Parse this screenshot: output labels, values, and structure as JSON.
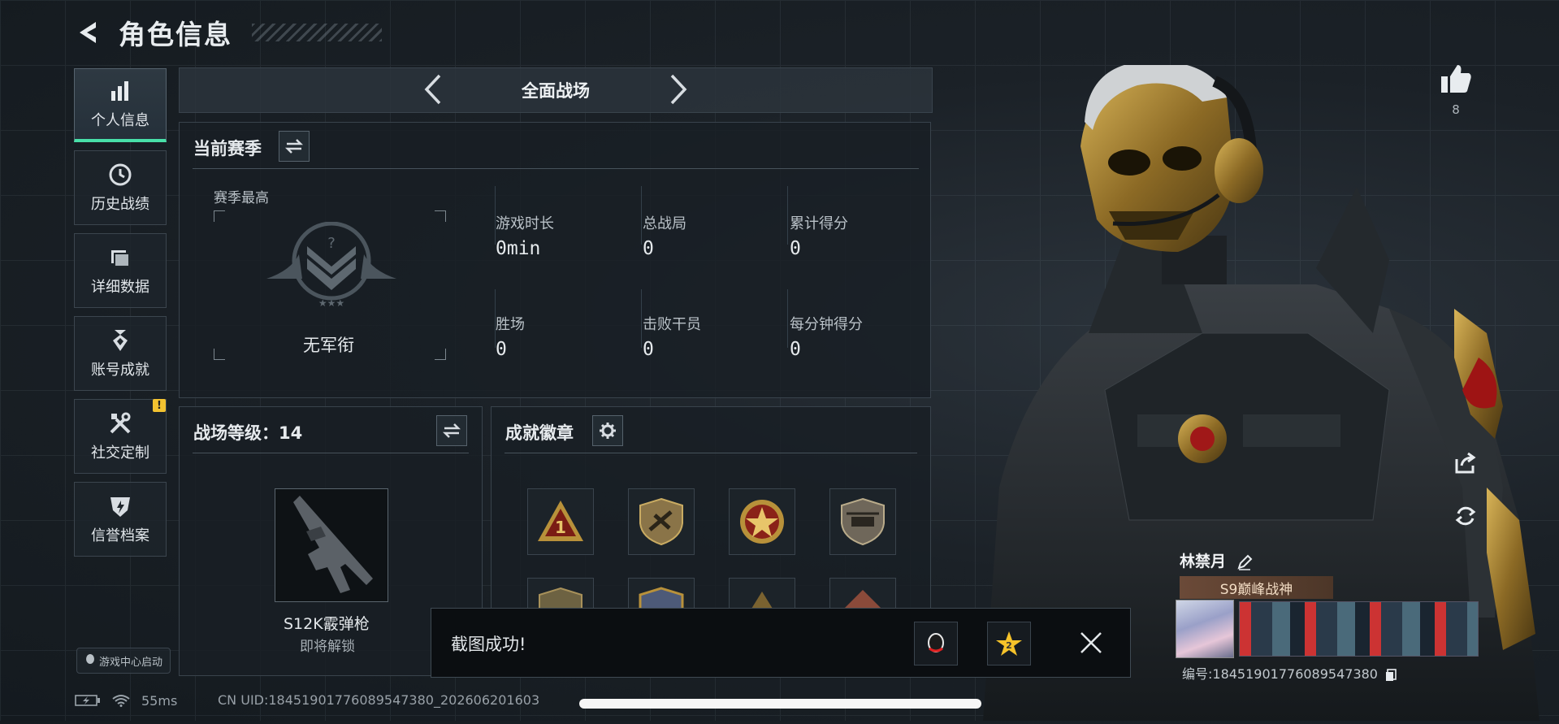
{
  "header": {
    "title": "角色信息"
  },
  "sidebar": {
    "items": [
      {
        "label": "个人信息",
        "icon": "bar-chart-icon",
        "active": true
      },
      {
        "label": "历史战绩",
        "icon": "clock-icon"
      },
      {
        "label": "详细数据",
        "icon": "folder-icon"
      },
      {
        "label": "账号成就",
        "icon": "medal-icon"
      },
      {
        "label": "社交定制",
        "icon": "tools-icon",
        "badge": "!"
      },
      {
        "label": "信誉档案",
        "icon": "shield-bolt-icon"
      }
    ],
    "game_center": "游戏中心启动"
  },
  "mode": {
    "label": "全面战场"
  },
  "season": {
    "title": "当前赛季",
    "best_label": "赛季最高",
    "rank": "无军衔",
    "stats": [
      {
        "label": "游戏时长",
        "value": "0min"
      },
      {
        "label": "总战局",
        "value": "0"
      },
      {
        "label": "累计得分",
        "value": "0"
      },
      {
        "label": "胜场",
        "value": "0"
      },
      {
        "label": "击败干员",
        "value": "0"
      },
      {
        "label": "每分钟得分",
        "value": "0"
      }
    ]
  },
  "level": {
    "title": "战场等级：14",
    "weapon_name": "S12K霰弹枪",
    "weapon_status": "即将解锁"
  },
  "achievements": {
    "title": "成就徽章"
  },
  "toast": {
    "message": "截图成功!"
  },
  "likes": {
    "count": "8"
  },
  "profile": {
    "name": "林禁月",
    "tag": "S9巅峰战神",
    "uid_label": "编号:1845190177608954738​0"
  },
  "status_bar": {
    "ping": "55ms",
    "cn_uid": "CN UID:18451901776089547380_202606201603"
  },
  "colors": {
    "accent": "#48e0a8",
    "warning": "#f2c230",
    "gold": "#b8913a"
  }
}
